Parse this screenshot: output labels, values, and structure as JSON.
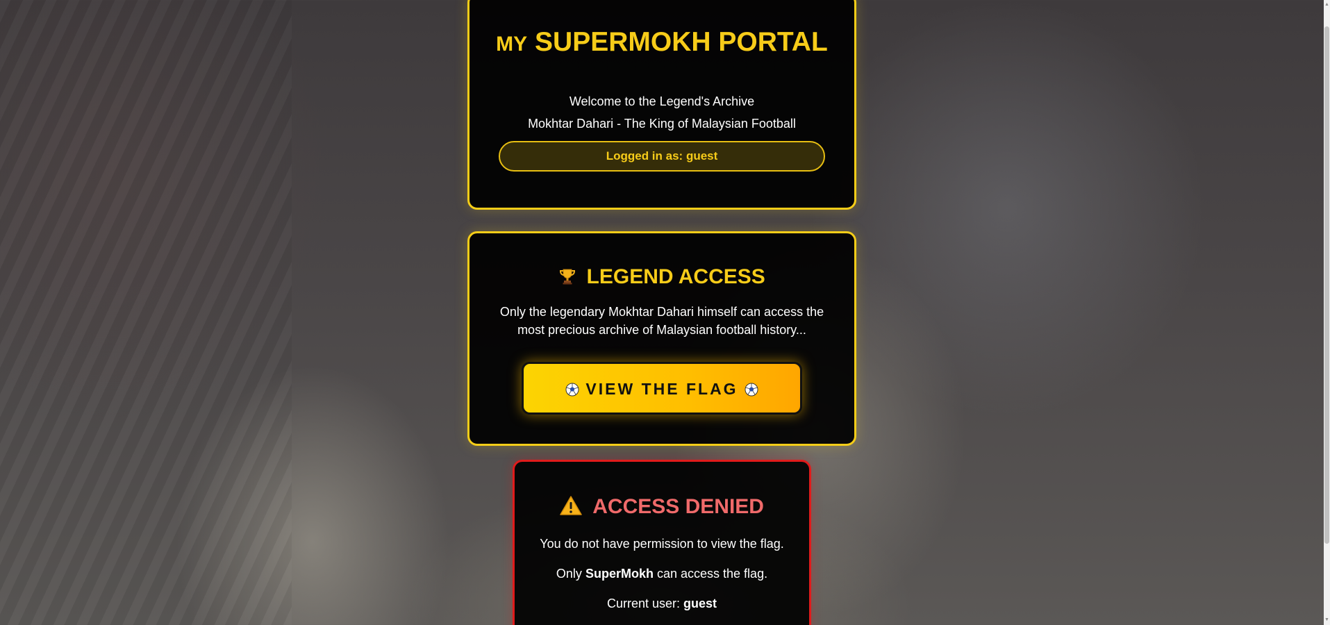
{
  "header": {
    "title_prefix": "MY",
    "title_main": "SUPERMOKH PORTAL",
    "welcome": "Welcome to the Legend's Archive",
    "tagline": "Mokhtar Dahari - The King of Malaysian Football",
    "logged_in_label": "Logged in as:",
    "logged_in_user": "guest"
  },
  "legend_access": {
    "icon": "trophy-icon",
    "title": "LEGEND ACCESS",
    "description": "Only the legendary Mokhtar Dahari himself can access the most precious archive of Malaysian football history...",
    "button_label": "VIEW THE FLAG",
    "button_icon": "soccer-ball-icon"
  },
  "access_denied": {
    "icon": "warning-icon",
    "title": "ACCESS DENIED",
    "line1": "You do not have permission to view the flag.",
    "line2_prefix": "Only",
    "line2_user": "SuperMokh",
    "line2_suffix": "can access the flag.",
    "line3_label": "Current user:",
    "line3_user": "guest"
  },
  "colors": {
    "accent": "#f7cc19",
    "danger_border": "#e01b1b",
    "danger_text": "#f06a6a",
    "card_bg": "#000000"
  }
}
